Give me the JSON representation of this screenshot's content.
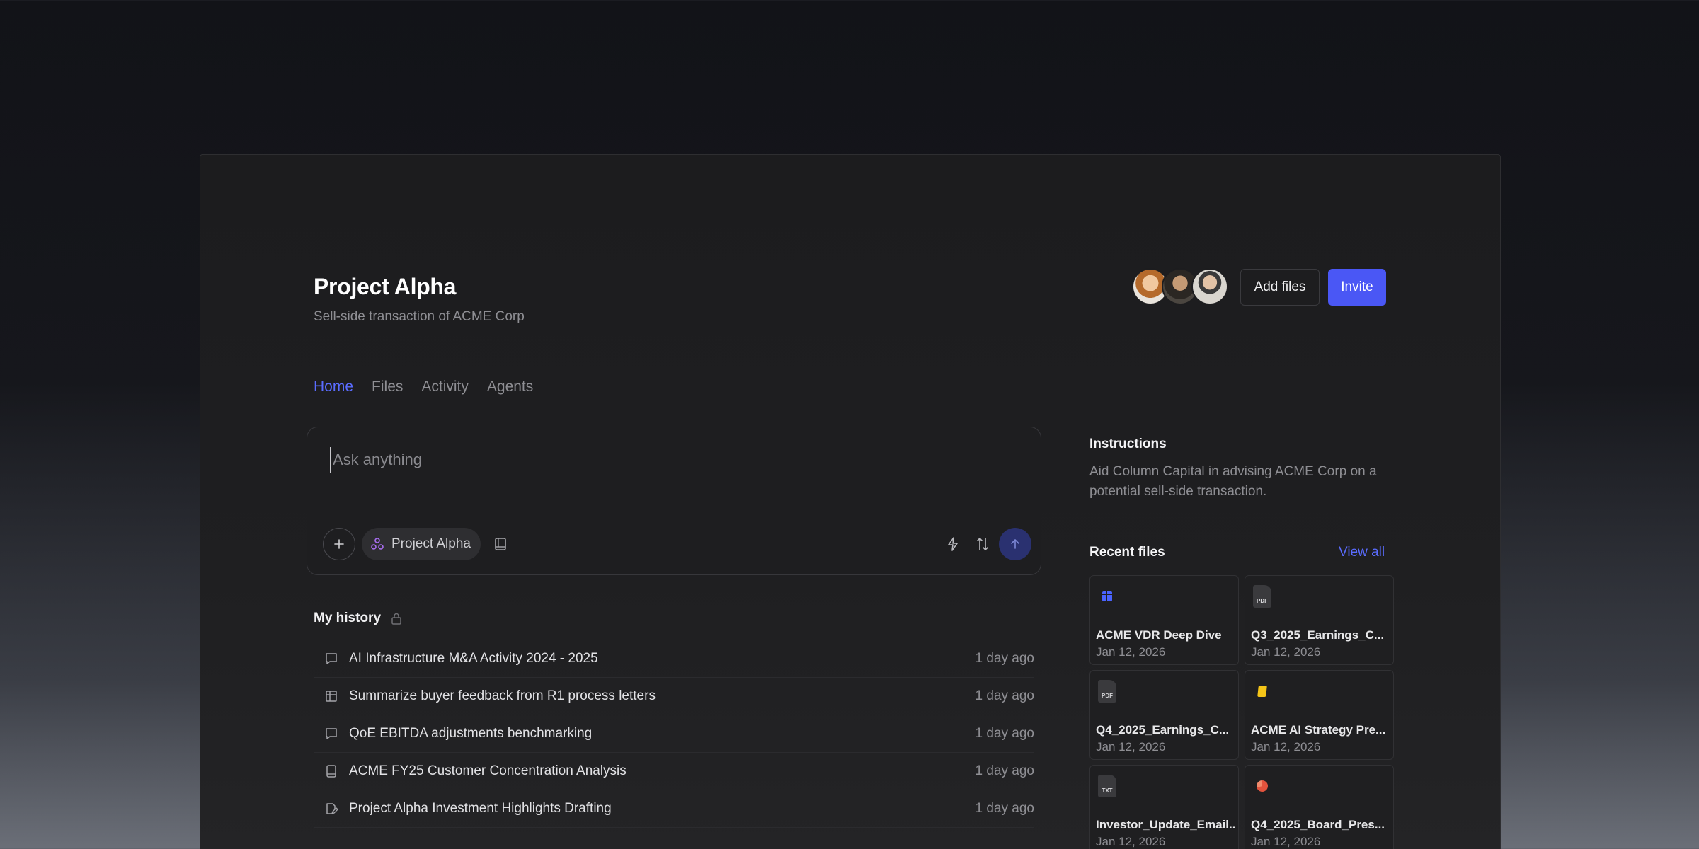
{
  "project": {
    "title": "Project Alpha",
    "subtitle": "Sell-side transaction of ACME Corp"
  },
  "header": {
    "add_files_label": "Add files",
    "invite_label": "Invite",
    "accent_color": "#4a57f5"
  },
  "tabs": [
    {
      "label": "Home",
      "active": true
    },
    {
      "label": "Files",
      "active": false
    },
    {
      "label": "Activity",
      "active": false
    },
    {
      "label": "Agents",
      "active": false
    }
  ],
  "composer": {
    "placeholder": "Ask anything",
    "value": "",
    "chip_label": "Project Alpha",
    "icons": [
      "plus-icon",
      "project-icon",
      "book-icon",
      "bolt-icon",
      "sort-icon",
      "send-arrow-icon"
    ]
  },
  "history": {
    "title": "My history",
    "items": [
      {
        "icon": "chat-icon",
        "title": "AI Infrastructure M&A Activity 2024 - 2025",
        "time": "1 day ago"
      },
      {
        "icon": "table-icon",
        "title": "Summarize buyer feedback from R1 process letters",
        "time": "1 day ago"
      },
      {
        "icon": "chat-icon",
        "title": "QoE EBITDA adjustments benchmarking",
        "time": "1 day ago"
      },
      {
        "icon": "book-icon",
        "title": "ACME FY25 Customer Concentration Analysis",
        "time": "1 day ago"
      },
      {
        "icon": "doc-edit-icon",
        "title": "Project Alpha Investment Highlights Drafting",
        "time": "1 day ago"
      }
    ]
  },
  "instructions": {
    "title": "Instructions",
    "text": "Aid Column Capital in advising ACME Corp on a potential sell-side transaction."
  },
  "recent_files": {
    "title": "Recent files",
    "view_all_label": "View all",
    "items": [
      {
        "type": "sheet",
        "name": "ACME VDR Deep Dive",
        "date": "Jan 12, 2026"
      },
      {
        "type": "pdf",
        "badge": "PDF",
        "name": "Q3_2025_Earnings_C...",
        "date": "Jan 12, 2026"
      },
      {
        "type": "pdf",
        "badge": "PDF",
        "name": "Q4_2025_Earnings_C...",
        "date": "Jan 12, 2026"
      },
      {
        "type": "slides",
        "name": "ACME AI Strategy Pre...",
        "date": "Jan 12, 2026"
      },
      {
        "type": "txt",
        "badge": "TXT",
        "name": "Investor_Update_Email...",
        "date": "Jan 12, 2026"
      },
      {
        "type": "pie",
        "name": "Q4_2025_Board_Pres...",
        "date": "Jan 12, 2026"
      }
    ]
  }
}
